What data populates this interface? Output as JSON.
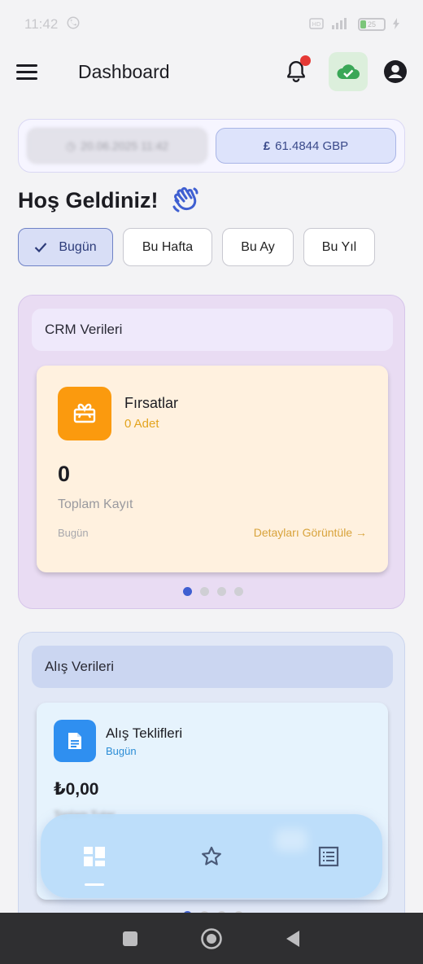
{
  "status_bar": {
    "time": "11:42",
    "battery": "25"
  },
  "app_bar": {
    "title": "Dashboard"
  },
  "info": {
    "date_time": "20.06.2025 11:42",
    "currency_symbol": "£",
    "currency_value": "61.4844 GBP"
  },
  "welcome": {
    "text": "Hoş Geldiniz!"
  },
  "filters": [
    "Bugün",
    "Bu Hafta",
    "Bu Ay",
    "Bu Yıl"
  ],
  "selected_filter": "Bugün",
  "crm": {
    "header": "CRM Verileri",
    "card_title": "Fırsatlar",
    "card_sub": "0 Adet",
    "value": "0",
    "value_label": "Toplam Kayıt",
    "period": "Bugün",
    "details_link": "Detayları Görüntüle →",
    "page_count": 4,
    "active_page": 1
  },
  "alis": {
    "header": "Alış Verileri",
    "card_title": "Alış Teklifleri",
    "card_sub": "Bugün",
    "value": "₺0,00",
    "value_label": "Toplam Tutar",
    "page_count": 4,
    "active_page": 1
  },
  "bottom_nav": {
    "items": [
      "dashboard-icon",
      "star-icon",
      "list-icon"
    ],
    "active": 0
  },
  "colors": {
    "accent": "#3f5fd1",
    "crm_bg": "#e9dcf3",
    "alis_bg": "#e2e8f6",
    "orange": "#fb9a0e",
    "blue": "#2f8ff0"
  }
}
